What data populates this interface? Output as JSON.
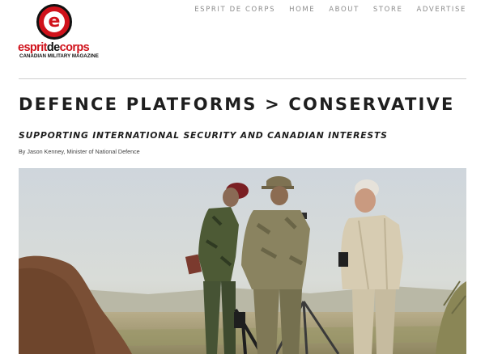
{
  "logo": {
    "mark_letter": "e",
    "word_part1": "esprit",
    "word_part2": "de",
    "word_part3": "corps",
    "tagline": "CANADIAN MILITARY MAGAZINE",
    "brand_red": "#d0121b"
  },
  "nav": {
    "items": [
      {
        "label": "ESPRIT DE CORPS"
      },
      {
        "label": "HOME"
      },
      {
        "label": "ABOUT"
      },
      {
        "label": "STORE"
      },
      {
        "label": "ADVERTISE"
      }
    ]
  },
  "article": {
    "title": "DEFENCE PLATFORMS > CONSERVATIVE",
    "subtitle": "SUPPORTING INTERNATIONAL SECURITY AND CANADIAN INTERESTS",
    "byline": "By Jason Kenney, Minister of National Defence"
  }
}
